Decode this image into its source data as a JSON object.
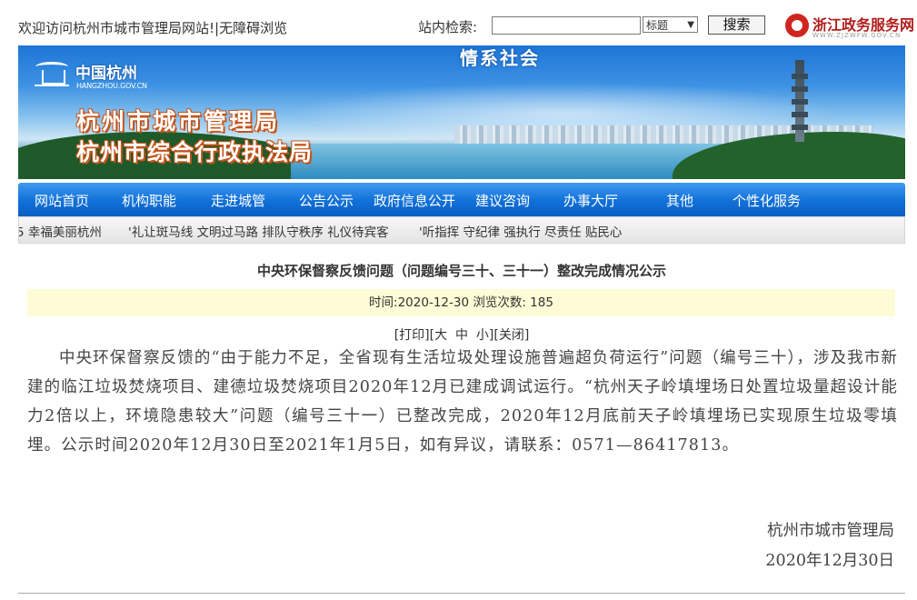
{
  "topbar": {
    "welcome": "欢迎访问杭州市城市管理局网站!",
    "accessibility": "|无障碍浏览",
    "search_label": "站内检索:",
    "search_value": "",
    "search_scope": "标题",
    "search_button": "搜索",
    "partner_logo_title": "浙江政务服务网",
    "partner_logo_sub": "WWW.ZJZWFW.GOV.CN"
  },
  "banner": {
    "tagline": "情系社会",
    "logo_name": "中国杭州",
    "logo_domain": "HANGZHOU.GOV.CN",
    "title_line1": "杭州市城市管理局",
    "title_line2": "杭州市综合行政执法局"
  },
  "nav": {
    "items": [
      {
        "label": "网站首页"
      },
      {
        "label": "机构职能"
      },
      {
        "label": "走进城管"
      },
      {
        "label": "公告公示"
      },
      {
        "label": "政府信息公开"
      },
      {
        "label": "建议咨询"
      },
      {
        "label": "办事大厅"
      },
      {
        "label": "其他"
      },
      {
        "label": "个性化服务"
      }
    ]
  },
  "ticker": {
    "messages": [
      "5 幸福美丽杭州",
      "'礼让斑马线 文明过马路 排队守秩序 礼仪待宾客",
      "'听指挥 守纪律 强执行 尽责任 贴民心"
    ]
  },
  "article": {
    "title": "中央环保督察反馈问题（问题编号三十、三十一）整改完成情况公示",
    "meta": "时间:2020-12-30 浏览次数:  185",
    "tools": {
      "print": "[打印]",
      "size_open": "[",
      "size_large": "大",
      "size_medium": "中",
      "size_small": "小",
      "size_close": "]",
      "close": "[关闭]"
    },
    "body": "中央环保督察反馈的“由于能力不足，全省现有生活垃圾处理设施普遍超负荷运行”问题（编号三十），涉及我市新建的临江垃圾焚烧项目、建德垃圾焚烧项目2020年12月已建成调试运行。“杭州天子岭填埋场日处置垃圾量超设计能力2倍以上，环境隐患较大”问题（编号三十一）已整改完成，2020年12月底前天子岭填埋场已实现原生垃圾零填埋。公示时间2020年12月30日至2021年1月5日，如有异议，请联系：0571—86417813。",
    "signature_org": "杭州市城市管理局",
    "signature_date": "2020年12月30日"
  },
  "colors": {
    "nav_blue": "#1170d8",
    "meta_background": "#fdfcd6",
    "title_shadow": "#c4541a"
  }
}
